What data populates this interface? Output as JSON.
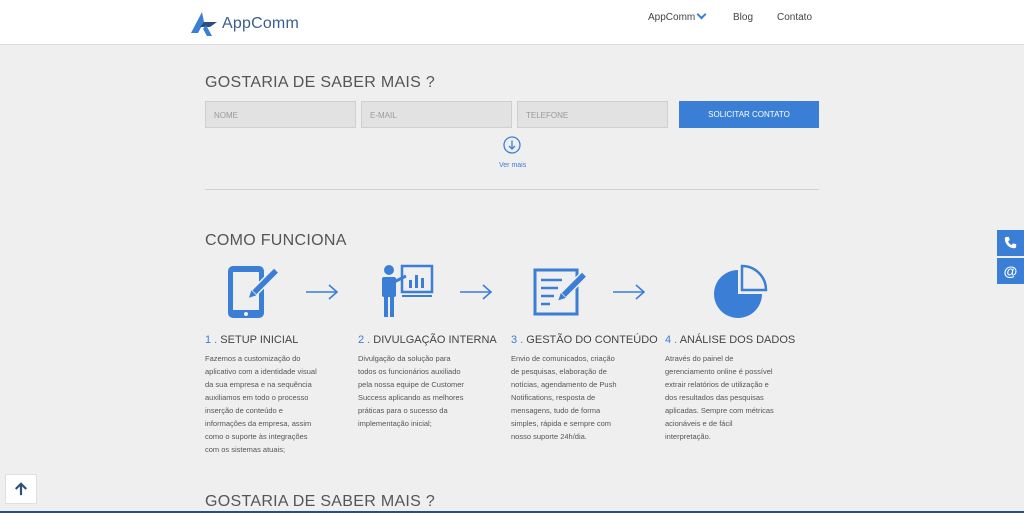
{
  "header": {
    "logo_text": "AppComm",
    "nav": [
      {
        "label": "AppComm"
      },
      {
        "label": "Blog"
      },
      {
        "label": "Contato"
      }
    ]
  },
  "contact_form": {
    "title": "GOSTARIA DE SABER MAIS ?",
    "name_placeholder": "NOME",
    "email_placeholder": "E-MAIL",
    "phone_placeholder": "TELEFONE",
    "submit_label": "SOLICITAR CONTATO",
    "see_more": "Ver mais"
  },
  "how_it_works": {
    "title": "COMO FUNCIONA",
    "steps": [
      {
        "number": "1 .",
        "title": "SETUP INICIAL",
        "icon": "tablet-edit-icon",
        "description": "Fazemos a customização do aplicativo com a identidade visual da sua empresa e na sequência auxiliamos em todo o processo inserção de conteúdo e informações da empresa, assim como o suporte às integrações com os sistemas atuais;"
      },
      {
        "number": "2 .",
        "title": "DIVULGAÇÃO INTERNA",
        "icon": "presenter-board-icon",
        "description": "Divulgação da solução para todos os funcionários auxiliado pela nossa equipe de Customer Success aplicando as melhores práticas para o sucesso da implementação inicial;"
      },
      {
        "number": "3 .",
        "title": "GESTÃO DO CONTEÚDO",
        "icon": "document-edit-icon",
        "description": "Envio de comunicados, criação de pesquisas, elaboração de notícias, agendamento de Push Notifications, resposta de mensagens, tudo de forma simples, rápida e sempre com nosso suporte 24h/dia."
      },
      {
        "number": "4 .",
        "title": "ANÁLISE DOS DADOS",
        "icon": "pie-chart-icon",
        "description": "Através do painel de gerenciamento online é possível extrair relatórios de utilização e dos resultados das pesquisas aplicadas. Sempre com métricas acionáveis e de fácil interpretação."
      }
    ]
  },
  "bottom_title": "GOSTARIA DE SABER MAIS ?",
  "side_buttons": {
    "phone_icon": "phone-icon",
    "email_label": "@"
  },
  "colors": {
    "accent": "#3a7fd5",
    "background": "#efefef",
    "logo": "#3a5f8a"
  }
}
